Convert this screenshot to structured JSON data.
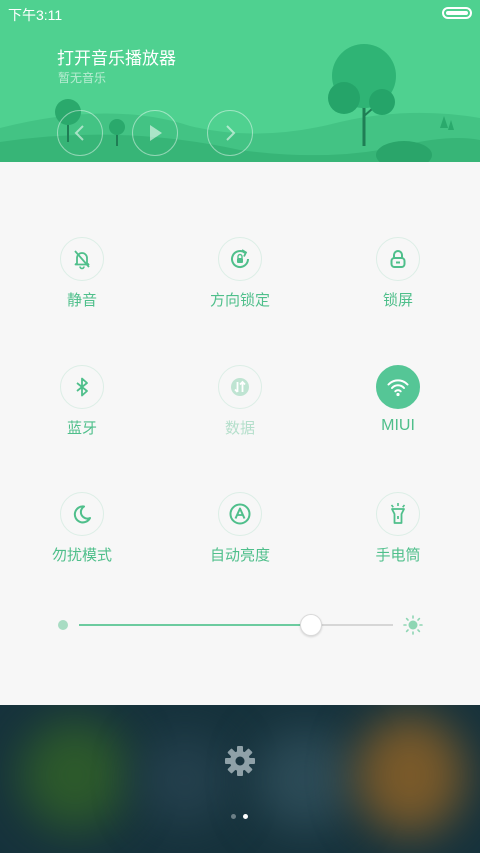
{
  "status_bar": {
    "time": "下午3:11"
  },
  "music": {
    "title": "打开音乐播放器",
    "subtitle": "暂无音乐",
    "controls": [
      "previous-icon",
      "play-icon",
      "next-icon"
    ]
  },
  "toggles": [
    {
      "label": "静音",
      "icon": "bell-off-icon",
      "active": false,
      "disabled": false
    },
    {
      "label": "方向锁定",
      "icon": "rotation-lock-icon",
      "active": false,
      "disabled": false
    },
    {
      "label": "锁屏",
      "icon": "lock-icon",
      "active": false,
      "disabled": false
    },
    {
      "label": "蓝牙",
      "icon": "bluetooth-icon",
      "active": false,
      "disabled": false
    },
    {
      "label": "数据",
      "icon": "mobile-data-icon",
      "active": false,
      "disabled": true
    },
    {
      "label": "MIUI",
      "icon": "wifi-icon",
      "active": true,
      "disabled": false
    },
    {
      "label": "勿扰模式",
      "icon": "moon-icon",
      "active": false,
      "disabled": false
    },
    {
      "label": "自动亮度",
      "icon": "auto-brightness-icon",
      "active": false,
      "disabled": false
    },
    {
      "label": "手电筒",
      "icon": "flashlight-icon",
      "active": false,
      "disabled": false
    }
  ],
  "brightness": {
    "level": 0.74
  },
  "dock": {
    "settings_icon": "gear-icon",
    "pages": 2,
    "current_page": 2
  },
  "colors": {
    "header_green": "#4fd190",
    "accent_green": "#4fbf8b",
    "active_circle": "#55c696",
    "panel_bg": "#f7f7f7",
    "dock_bg": "#16323c"
  }
}
